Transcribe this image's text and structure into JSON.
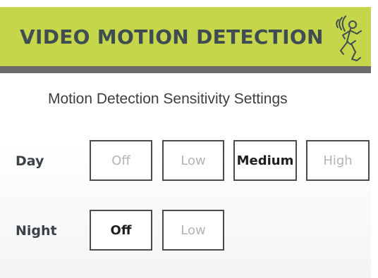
{
  "header": {
    "title": "VIDEO MOTION DETECTION",
    "icon": "motion-sensor-person-icon",
    "accent_color": "#c5d64a"
  },
  "section": {
    "title": "Motion Detection Sensitivity Settings"
  },
  "rows": [
    {
      "label": "Day",
      "options": [
        "Off",
        "Low",
        "Medium",
        "High"
      ],
      "selected": "Medium"
    },
    {
      "label": "Night",
      "options": [
        "Off",
        "Low"
      ],
      "selected": "Off"
    }
  ]
}
